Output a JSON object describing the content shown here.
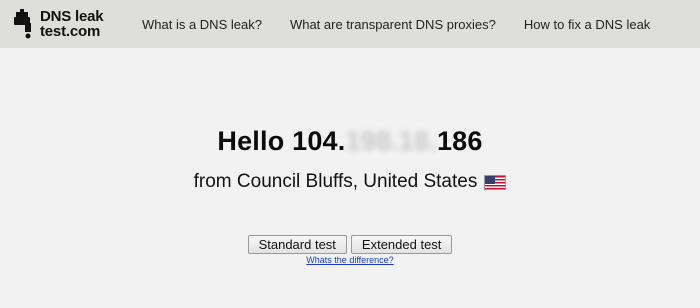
{
  "logo": {
    "line1": "DNS leak",
    "line2": "test.com",
    "icon": "faucet-icon"
  },
  "nav": [
    {
      "label": "What is a DNS leak?"
    },
    {
      "label": "What are transparent DNS proxies?"
    },
    {
      "label": "How to fix a DNS leak"
    }
  ],
  "greeting": {
    "prefix": "Hello 104.",
    "blurred": "198.18.",
    "suffix": "186"
  },
  "location": {
    "text": "from Council Bluffs, United States",
    "flag_icon": "us-flag-icon"
  },
  "buttons": {
    "standard": "Standard test",
    "extended": "Extended test"
  },
  "difference_link": "Whats the difference?",
  "colors": {
    "header_bg": "#dededb",
    "page_bg": "#f2f2f2",
    "link": "#1a3cc8"
  }
}
